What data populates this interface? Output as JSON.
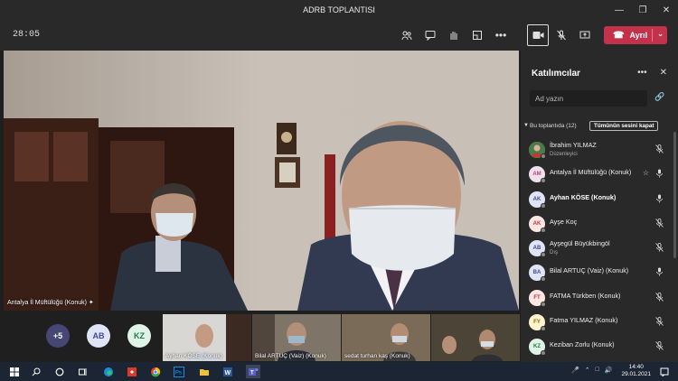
{
  "window": {
    "title": "ADRB TOPLANTISI"
  },
  "toolbar": {
    "timer": "28:05",
    "leave_label": "Ayrıl"
  },
  "main_video": {
    "label": "Antalya İl Müftülüğü (Konuk)"
  },
  "strip": {
    "bubbles": [
      {
        "text": "+5",
        "color": "#464775"
      },
      {
        "text": "AB",
        "color": "#dfe4f6",
        "fg": "#444791"
      },
      {
        "text": "KZ",
        "color": "#dff3e6",
        "fg": "#237b4b"
      }
    ],
    "thumbs": [
      {
        "label": "Ayhan KÖSE (Konuk)"
      },
      {
        "label": "Bilal ARTUÇ (Vaiz) (Konuk)"
      },
      {
        "label": "sedat turhan kaş (Konuk)"
      },
      {
        "label": ""
      }
    ]
  },
  "panel": {
    "title": "Katılımcılar",
    "search_placeholder": "Ad yazın",
    "section_label": "Bu toplantıda (12)",
    "mute_all": "Tümünün sesini kapat",
    "participants": [
      {
        "initials": "",
        "name": "İbrahim YILMAZ",
        "role": "Düzenleyici",
        "bold": false,
        "avatar_color": "#6b8e5a",
        "mic": "muted",
        "hand": false,
        "photo": true
      },
      {
        "initials": "AM",
        "name": "Antalya İl Müftülüğü (Konuk)",
        "role": "",
        "bold": false,
        "avatar_color": "#f0e0e9",
        "fg": "#b24782",
        "mic": "on",
        "hand": true
      },
      {
        "initials": "AK",
        "name": "Ayhan KÖSE (Konuk)",
        "role": "",
        "bold": true,
        "avatar_color": "#dfe4f6",
        "fg": "#444791",
        "mic": "on",
        "hand": false
      },
      {
        "initials": "AK",
        "name": "Ayşe Koç",
        "role": "",
        "bold": false,
        "avatar_color": "#fde7e0",
        "fg": "#c4314b",
        "mic": "muted",
        "hand": false
      },
      {
        "initials": "AB",
        "name": "Ayşegül Büyükbingöl",
        "role": "Dış",
        "bold": false,
        "avatar_color": "#dfe4f6",
        "fg": "#444791",
        "mic": "muted",
        "hand": false
      },
      {
        "initials": "BA",
        "name": "Bilal ARTUÇ (Vaiz) (Konuk)",
        "role": "",
        "bold": false,
        "avatar_color": "#dfe4f6",
        "fg": "#444791",
        "mic": "on",
        "hand": false
      },
      {
        "initials": "FT",
        "name": "FATMA Türkben (Konuk)",
        "role": "",
        "bold": false,
        "avatar_color": "#fde7e0",
        "fg": "#c4314b",
        "mic": "muted",
        "hand": false
      },
      {
        "initials": "FY",
        "name": "Fatma YILMAZ (Konuk)",
        "role": "",
        "bold": false,
        "avatar_color": "#fff4ce",
        "fg": "#8a6d00",
        "mic": "muted",
        "hand": false
      },
      {
        "initials": "KZ",
        "name": "Keziban Zorlu (Konuk)",
        "role": "",
        "bold": false,
        "avatar_color": "#dff3e6",
        "fg": "#237b4b",
        "mic": "muted",
        "hand": false
      }
    ]
  },
  "taskbar": {
    "time": "14:40",
    "date": "29.01.2021"
  },
  "colors": {
    "accent": "#6264a7",
    "leave": "#c4314b",
    "bg": "#1f1f1f",
    "panel": "#292929"
  }
}
